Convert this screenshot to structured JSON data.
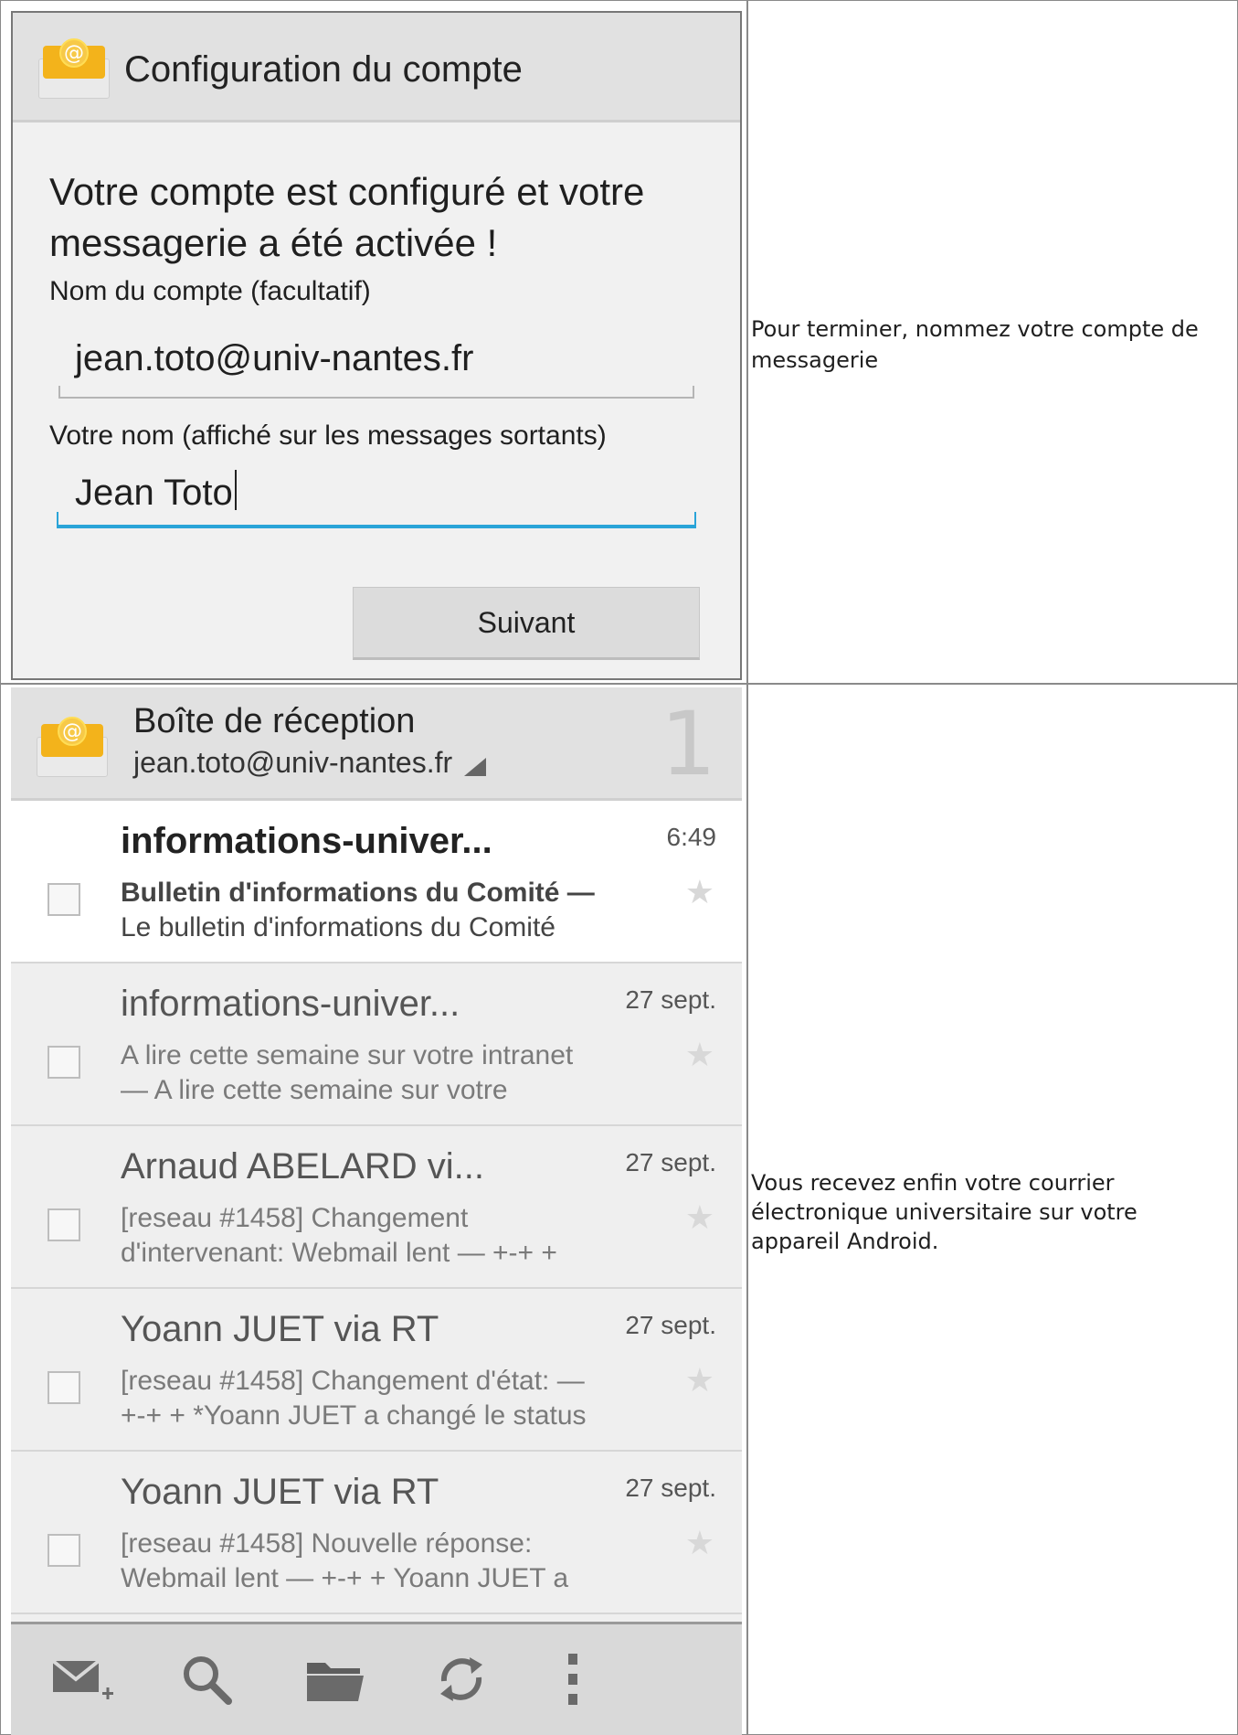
{
  "step1": {
    "actionbar_title": "Configuration du compte",
    "heading": "Votre compte est configuré et votre messagerie a été activée !",
    "account_name_label": "Nom du compte (facultatif)",
    "account_name_value": "jean.toto@univ-nantes.fr",
    "your_name_label": "Votre nom (affiché sur les messages sortants)",
    "your_name_value": "Jean Toto",
    "next_button": "Suivant",
    "caption_line1": "Pour terminer, nommez votre compte de",
    "caption_line2": "messagerie"
  },
  "step2": {
    "title": "Boîte de réception",
    "account": "jean.toto@univ-nantes.fr",
    "unread_count": "1",
    "messages": [
      {
        "sender": "informations-univer...",
        "date": "6:49",
        "line1": "Bulletin d'informations du Comité —",
        "line2": "Le bulletin d'informations du Comité",
        "unread": true
      },
      {
        "sender": "informations-univer...",
        "date": "27 sept.",
        "line1": "A lire cette semaine sur votre intranet",
        "line2": "— A lire cette semaine sur votre",
        "unread": false
      },
      {
        "sender": "Arnaud ABELARD vi...",
        "date": "27 sept.",
        "line1": "[reseau #1458] Changement",
        "line2": "d'intervenant: Webmail lent — +-+ +",
        "unread": false
      },
      {
        "sender": "Yoann JUET via RT",
        "date": "27 sept.",
        "line1": "[reseau #1458] Changement d'état: —",
        "line2": "+-+ + *Yoann JUET a changé le status",
        "unread": false
      },
      {
        "sender": "Yoann JUET via RT",
        "date": "27 sept.",
        "line1": "[reseau #1458] Nouvelle réponse:",
        "line2": "Webmail lent — +-+ + Yoann JUET a",
        "unread": false
      }
    ],
    "bottom_actions": [
      "compose-icon",
      "search-icon",
      "folder-icon",
      "refresh-icon",
      "overflow-menu-icon"
    ],
    "caption_line1": "Vous recevez enfin votre courrier",
    "caption_line2": "électronique universitaire sur votre",
    "caption_line3": "appareil Android."
  },
  "colors": {
    "accent_blue": "#2aa4d8",
    "actionbar_gray": "#e1e1e1",
    "email_icon_orange": "#f3b31b"
  }
}
